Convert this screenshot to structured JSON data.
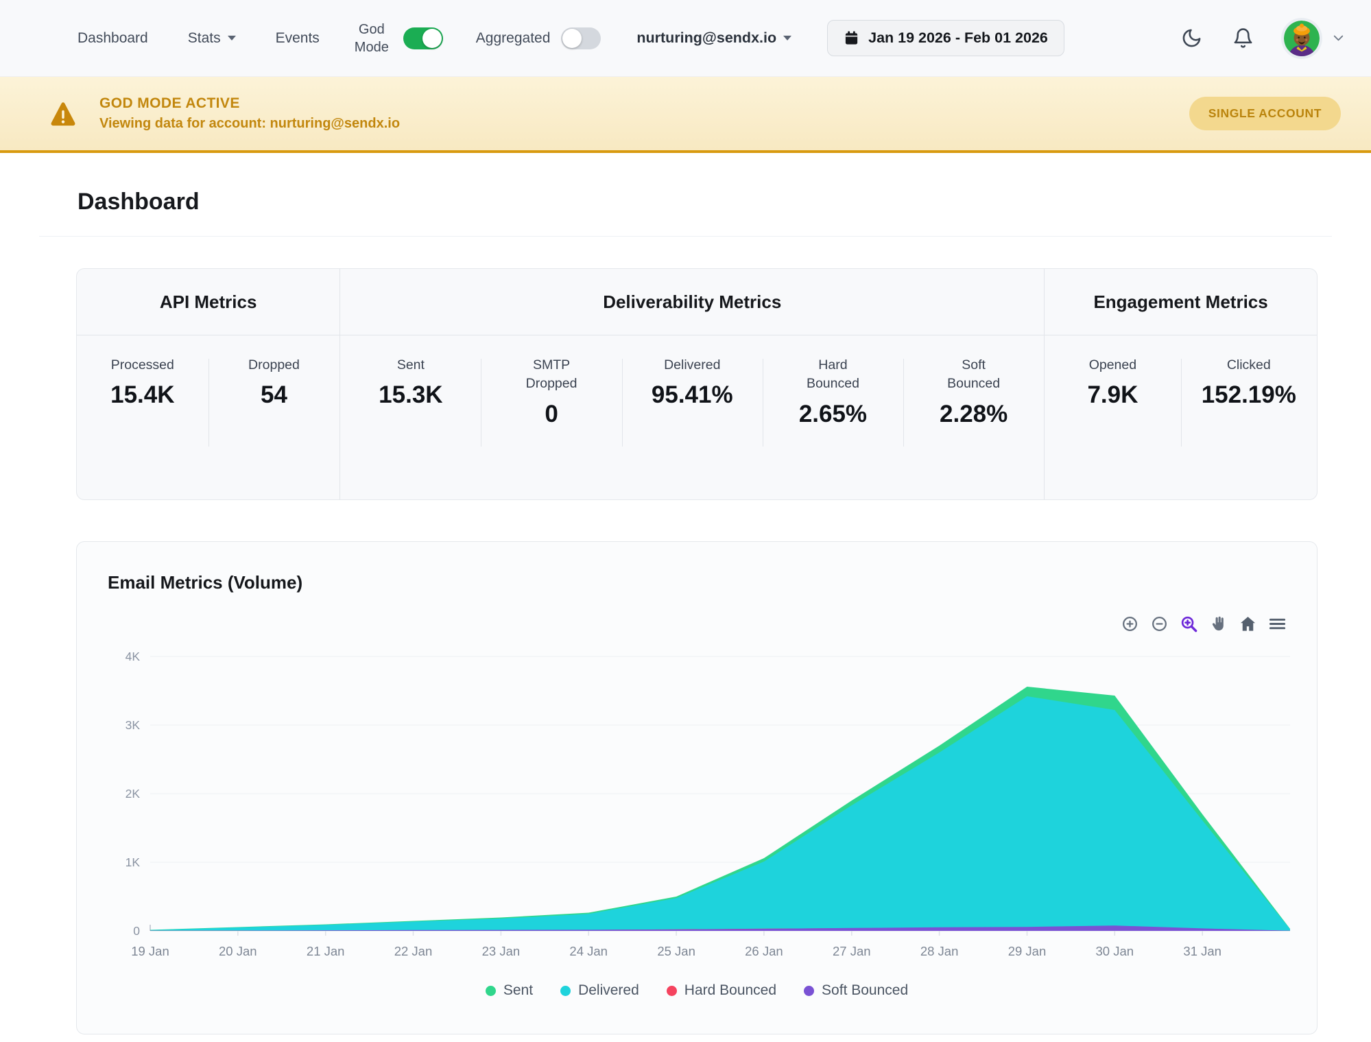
{
  "nav": {
    "links": [
      "Dashboard",
      "Stats",
      "Events"
    ],
    "god_mode": {
      "label": "God Mode",
      "state": "on"
    },
    "aggregated": {
      "label": "Aggregated",
      "state": "off"
    },
    "account": "nurturing@sendx.io",
    "date_range": "Jan 19 2026 - Feb 01 2026",
    "icons": [
      "calendar-icon",
      "moon-icon",
      "bell-icon",
      "avatar",
      "chevron-down-icon"
    ]
  },
  "banner": {
    "title": "GOD MODE ACTIVE",
    "subtitle": "Viewing data for account: nurturing@sendx.io",
    "badge": "SINGLE ACCOUNT",
    "icon": "warning-icon",
    "accent_color": "#c2870e",
    "border_color": "#d89a10"
  },
  "page": {
    "title": "Dashboard"
  },
  "metrics": {
    "groups": [
      {
        "title": "API Metrics",
        "stats": [
          {
            "label": "Processed",
            "value": "15.4K"
          },
          {
            "label": "Dropped",
            "value": "54"
          }
        ]
      },
      {
        "title": "Deliverability Metrics",
        "stats": [
          {
            "label": "Sent",
            "value": "15.3K"
          },
          {
            "label": "SMTP Dropped",
            "value": "0"
          },
          {
            "label": "Delivered",
            "value": "95.41%"
          },
          {
            "label": "Hard Bounced",
            "value": "2.65%"
          },
          {
            "label": "Soft Bounced",
            "value": "2.28%"
          }
        ]
      },
      {
        "title": "Engagement Metrics",
        "stats": [
          {
            "label": "Opened",
            "value": "7.9K"
          },
          {
            "label": "Clicked",
            "value": "152.19%"
          }
        ]
      }
    ]
  },
  "chart": {
    "title": "Email Metrics (Volume)",
    "toolbar": [
      "zoom-in-icon",
      "zoom-out-icon",
      "selection-zoom-icon",
      "pan-icon",
      "home-icon",
      "menu-icon"
    ],
    "toolbar_active_color": "#6d28d9"
  },
  "chart_data": {
    "type": "area",
    "title": "Email Metrics (Volume)",
    "x": [
      "19 Jan",
      "20 Jan",
      "21 Jan",
      "22 Jan",
      "23 Jan",
      "24 Jan",
      "25 Jan",
      "26 Jan",
      "27 Jan",
      "28 Jan",
      "29 Jan",
      "30 Jan",
      "31 Jan",
      "1 Feb"
    ],
    "x_ticks": [
      "19 Jan",
      "20 Jan",
      "21 Jan",
      "22 Jan",
      "23 Jan",
      "24 Jan",
      "25 Jan",
      "26 Jan",
      "27 Jan",
      "28 Jan",
      "29 Jan",
      "30 Jan",
      "31 Jan"
    ],
    "y_ticks": [
      "4K",
      "3K",
      "2K",
      "1K",
      "0"
    ],
    "ylim": [
      0,
      4000
    ],
    "grid": true,
    "legend_position": "bottom",
    "series": [
      {
        "name": "Sent",
        "color": "#30d68c",
        "values": [
          15,
          55,
          95,
          145,
          195,
          265,
          500,
          1060,
          1900,
          2700,
          3560,
          3430,
          1700,
          30
        ]
      },
      {
        "name": "Delivered",
        "color": "#1ed3dc",
        "values": [
          12,
          50,
          88,
          135,
          180,
          248,
          478,
          1010,
          1830,
          2600,
          3420,
          3220,
          1610,
          25
        ]
      },
      {
        "name": "Hard Bounced",
        "color": "#f5435f",
        "values": [
          2,
          4,
          6,
          8,
          10,
          14,
          22,
          32,
          40,
          46,
          50,
          46,
          28,
          3
        ]
      },
      {
        "name": "Soft Bounced",
        "color": "#7a52d4",
        "values": [
          1,
          3,
          8,
          12,
          14,
          16,
          20,
          30,
          42,
          52,
          58,
          78,
          36,
          2
        ]
      }
    ]
  }
}
